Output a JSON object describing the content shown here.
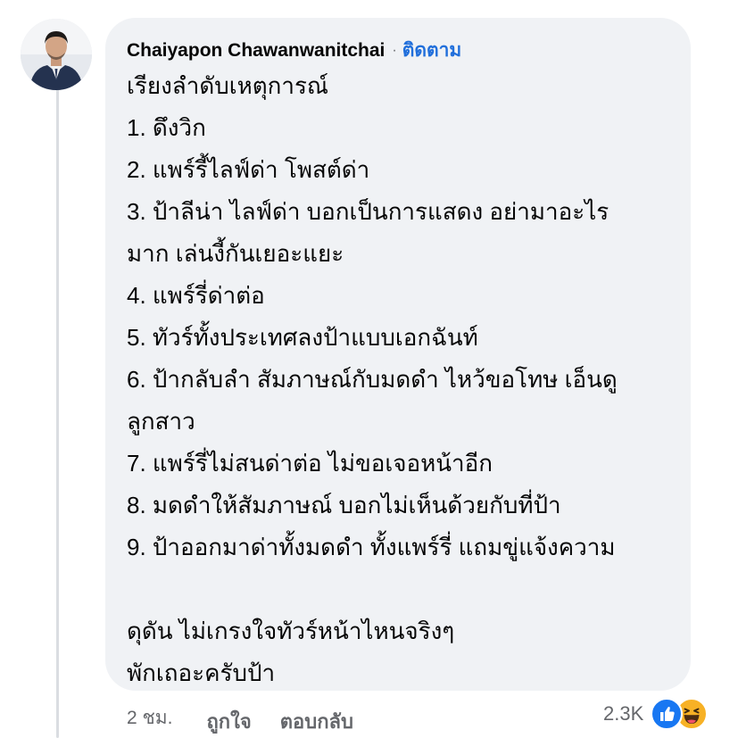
{
  "comment": {
    "author": "Chaiyapon Chawanwanitchai",
    "separator": "·",
    "follow_label": "ติดตาม",
    "lines": [
      "เรียงลำดับเหตุการณ์",
      "1. ดึงวิก",
      "2. แพร์รี้ไลฟ์ด่า โพสต์ด่า",
      "3. ป้าลีน่า ไลฟ์ด่า บอกเป็นการแสดง อย่ามาอะไร",
      "มาก เล่นงี้กันเยอะแยะ",
      "4. แพร์รี่ด่าต่อ",
      "5. ทัวร์ทั้งประเทศลงป้าแบบเอกฉันท์",
      "6. ป้ากลับลำ สัมภาษณ์กับมดดำ ไหว้ขอโทษ เอ็นดู",
      "ลูกสาว",
      "7. แพร์รี่ไม่สนด่าต่อ ไม่ขอเจอหน้าอีก",
      "8. มดดำให้สัมภาษณ์ บอกไม่เห็นด้วยกับที่ป้า",
      "9. ป้าออกมาด่าทั้งมดดำ ทั้งแพร์รี่ แถมขู่แจ้งความ",
      "",
      "ดุดัน ไม่เกรงใจทัวร์หน้าไหนจริงๆ",
      "พักเถอะครับป้า"
    ]
  },
  "meta": {
    "time": "2 ชม.",
    "like_label": "ถูกใจ",
    "reply_label": "ตอบกลับ"
  },
  "reactions": {
    "count": "2.3K",
    "icons": [
      "like-icon",
      "haha-icon"
    ],
    "like_color": "#1877f2",
    "haha_color": "#f7b125"
  },
  "colors": {
    "bubble_bg": "#f0f2f5",
    "link_blue": "#216fdb",
    "secondary_text": "#65676b"
  }
}
